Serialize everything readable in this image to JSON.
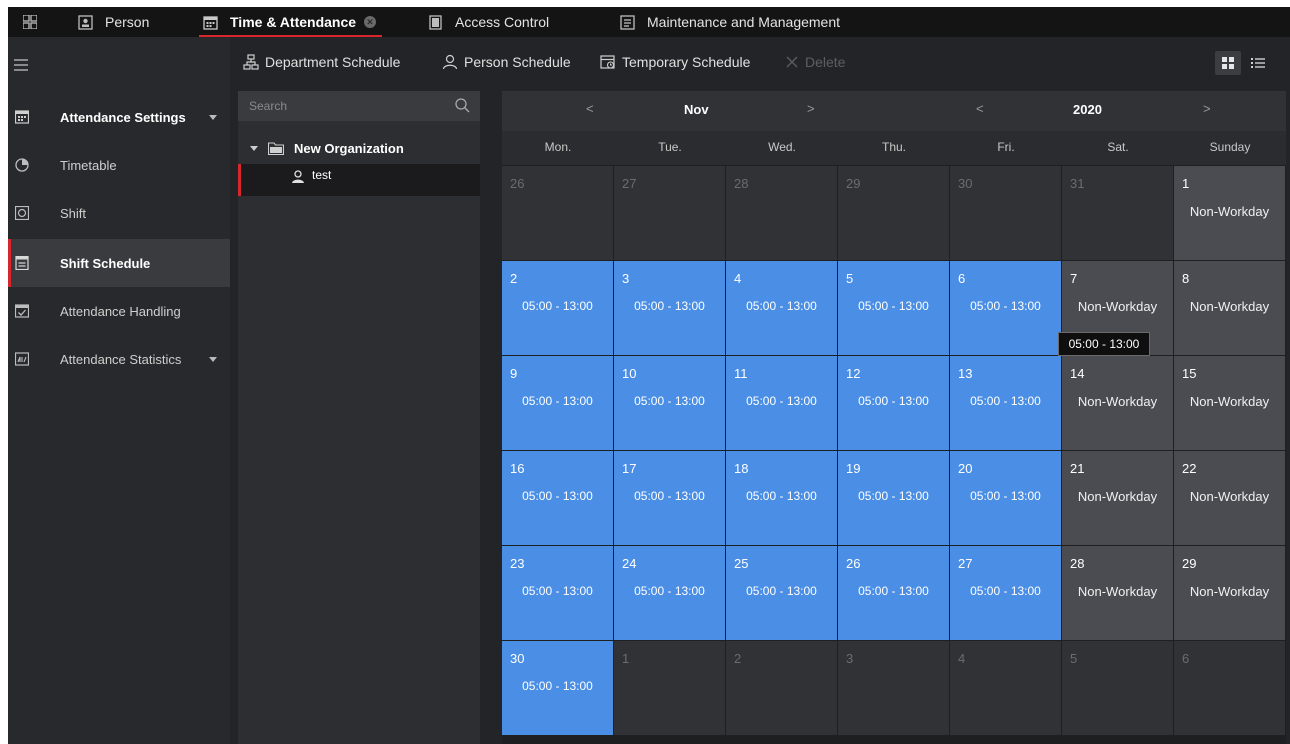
{
  "top_tabs": [
    {
      "label": "Person",
      "icon": "person-card-icon"
    },
    {
      "label": "Time & Attendance",
      "icon": "calendar-icon",
      "active": true
    },
    {
      "label": "Access Control",
      "icon": "door-icon"
    },
    {
      "label": "Maintenance and Management",
      "icon": "maintenance-icon"
    }
  ],
  "sidebar": {
    "items": [
      {
        "label": "Attendance Settings",
        "icon": "calendar-icon",
        "type": "group",
        "expanded": true
      },
      {
        "label": "Timetable",
        "icon": "clock-icon"
      },
      {
        "label": "Shift",
        "icon": "shift-icon"
      },
      {
        "label": "Shift Schedule",
        "icon": "schedule-icon",
        "selected": true
      },
      {
        "label": "Attendance Handling",
        "icon": "handling-icon"
      },
      {
        "label": "Attendance Statistics",
        "icon": "statistics-icon",
        "type": "group"
      }
    ]
  },
  "toolbar": {
    "department_schedule": "Department Schedule",
    "person_schedule": "Person Schedule",
    "temporary_schedule": "Temporary Schedule",
    "delete": "Delete"
  },
  "org": {
    "search_placeholder": "Search",
    "organization": "New Organization",
    "person": "test"
  },
  "calendar": {
    "month": "Nov",
    "year": "2020",
    "weekdays": [
      "Mon.",
      "Tue.",
      "Wed.",
      "Thu.",
      "Fri.",
      "Sat.",
      "Sunday"
    ],
    "colors": {
      "scheduled": "#4a8ee6",
      "non_workday": "#4a4c52",
      "other_month": "#303236",
      "accent": "#d8262d"
    },
    "weeks": [
      [
        {
          "d": "26",
          "s": "other"
        },
        {
          "d": "27",
          "s": "other"
        },
        {
          "d": "28",
          "s": "other"
        },
        {
          "d": "29",
          "s": "other"
        },
        {
          "d": "30",
          "s": "other"
        },
        {
          "d": "31",
          "s": "other"
        },
        {
          "d": "1",
          "s": "nonwork",
          "t": "Non-Workday"
        }
      ],
      [
        {
          "d": "2",
          "s": "sched",
          "t": "05:00 - 13:00"
        },
        {
          "d": "3",
          "s": "sched",
          "t": "05:00 - 13:00"
        },
        {
          "d": "4",
          "s": "sched",
          "t": "05:00 - 13:00"
        },
        {
          "d": "5",
          "s": "sched",
          "t": "05:00 - 13:00"
        },
        {
          "d": "6",
          "s": "sched",
          "t": "05:00 - 13:00"
        },
        {
          "d": "7",
          "s": "nonwork",
          "t": "Non-Workday"
        },
        {
          "d": "8",
          "s": "nonwork",
          "t": "Non-Workday"
        }
      ],
      [
        {
          "d": "9",
          "s": "sched",
          "t": "05:00 - 13:00"
        },
        {
          "d": "10",
          "s": "sched",
          "t": "05:00 - 13:00"
        },
        {
          "d": "11",
          "s": "sched",
          "t": "05:00 - 13:00"
        },
        {
          "d": "12",
          "s": "sched",
          "t": "05:00 - 13:00"
        },
        {
          "d": "13",
          "s": "sched",
          "t": "05:00 - 13:00"
        },
        {
          "d": "14",
          "s": "nonwork",
          "t": "Non-Workday"
        },
        {
          "d": "15",
          "s": "nonwork",
          "t": "Non-Workday"
        }
      ],
      [
        {
          "d": "16",
          "s": "sched",
          "t": "05:00 - 13:00"
        },
        {
          "d": "17",
          "s": "sched",
          "t": "05:00 - 13:00"
        },
        {
          "d": "18",
          "s": "sched",
          "t": "05:00 - 13:00"
        },
        {
          "d": "19",
          "s": "sched",
          "t": "05:00 - 13:00"
        },
        {
          "d": "20",
          "s": "sched",
          "t": "05:00 - 13:00"
        },
        {
          "d": "21",
          "s": "nonwork",
          "t": "Non-Workday"
        },
        {
          "d": "22",
          "s": "nonwork",
          "t": "Non-Workday"
        }
      ],
      [
        {
          "d": "23",
          "s": "sched",
          "t": "05:00 - 13:00"
        },
        {
          "d": "24",
          "s": "sched",
          "t": "05:00 - 13:00"
        },
        {
          "d": "25",
          "s": "sched",
          "t": "05:00 - 13:00"
        },
        {
          "d": "26",
          "s": "sched",
          "t": "05:00 - 13:00"
        },
        {
          "d": "27",
          "s": "sched",
          "t": "05:00 - 13:00"
        },
        {
          "d": "28",
          "s": "nonwork",
          "t": "Non-Workday"
        },
        {
          "d": "29",
          "s": "nonwork",
          "t": "Non-Workday"
        }
      ],
      [
        {
          "d": "30",
          "s": "sched",
          "t": "05:00 - 13:00"
        },
        {
          "d": "1",
          "s": "other"
        },
        {
          "d": "2",
          "s": "other"
        },
        {
          "d": "3",
          "s": "other"
        },
        {
          "d": "4",
          "s": "other"
        },
        {
          "d": "5",
          "s": "other"
        },
        {
          "d": "6",
          "s": "other"
        }
      ]
    ],
    "tooltip": "05:00 - 13:00"
  }
}
